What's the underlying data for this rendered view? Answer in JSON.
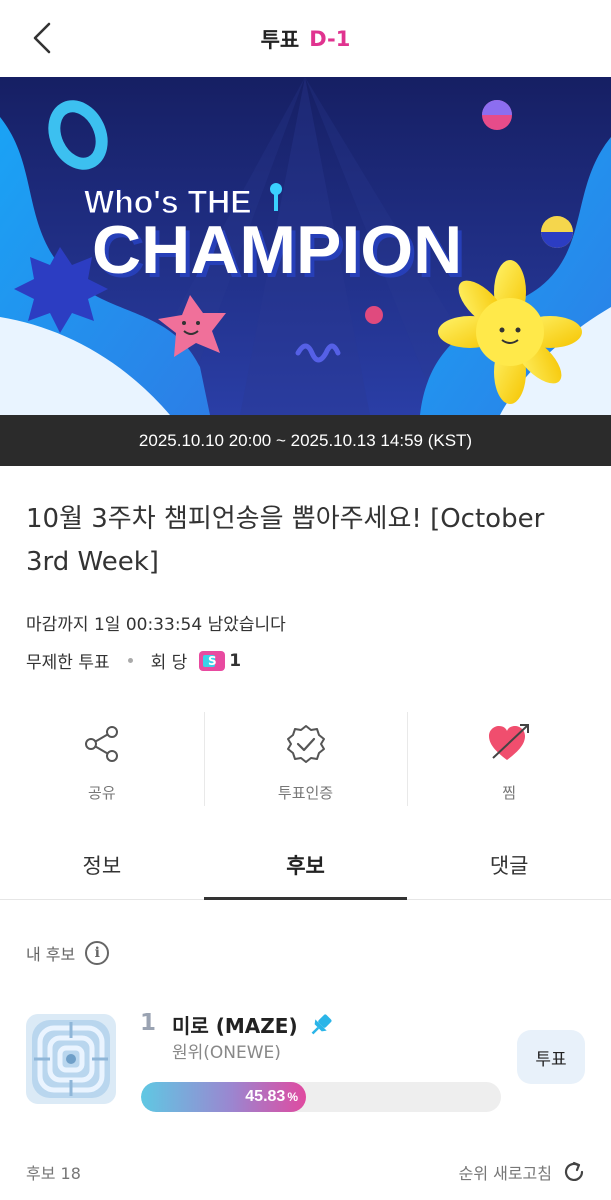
{
  "header": {
    "title": "투표",
    "dday": "D-1"
  },
  "banner": {
    "line1": "Who's THE",
    "line2": "CHAMPION"
  },
  "date_range": "2025.10.10 20:00 ~ 2025.10.13 14:59 (KST)",
  "vote": {
    "title": "10월 3주차 챔피언송을 뽑아주세요! [October 3rd Week]",
    "remaining": "마감까지 1일 00:33:54 남았습니다",
    "unlimited": "무제한 투표",
    "per_label": "회 당",
    "per_count": "1",
    "badge_letter": "S"
  },
  "actions": [
    {
      "label": "공유",
      "icon": "share-icon"
    },
    {
      "label": "투표인증",
      "icon": "verified-badge-icon"
    },
    {
      "label": "찜",
      "icon": "heart-arrow-icon"
    }
  ],
  "tabs": [
    {
      "label": "정보",
      "active": false
    },
    {
      "label": "후보",
      "active": true
    },
    {
      "label": "댓글",
      "active": false
    }
  ],
  "my_candidate": {
    "label": "내 후보",
    "info_glyph": "i"
  },
  "candidates": [
    {
      "rank": "1",
      "song": "미로 (MAZE)",
      "artist": "원위(ONEWE)",
      "percent": "45.83",
      "percent_unit": "%",
      "fraction": 0.4583,
      "vote_label": "투표"
    }
  ],
  "footer": {
    "count_label": "후보 18",
    "refresh_label": "순위 새로고침"
  },
  "colors": {
    "accent_pink": "#e0338f",
    "vote_button_bg": "#e8f1fa",
    "date_bar_bg": "#2b2b2b",
    "heart": "#f04e6e"
  }
}
